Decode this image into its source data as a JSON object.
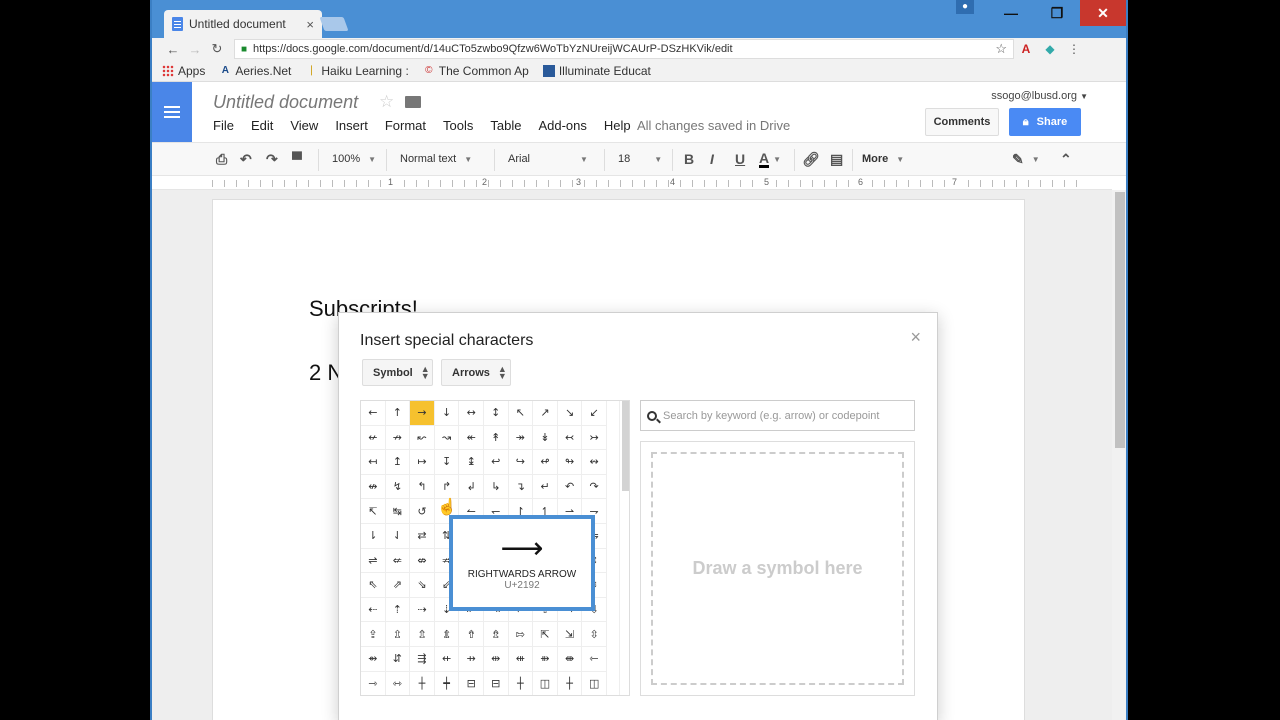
{
  "browser": {
    "tab_title": "Untitled document",
    "tab_close": "×",
    "url": "https://docs.google.com/document/d/14uCTo5zwbo9Qfzw6WoTbYzNUreijWCAUrP-DSzHKVik/edit",
    "window_controls": {
      "minimize": "—",
      "maximize": "❐",
      "close": "✕"
    },
    "bookmarks": [
      "Apps",
      "Aeries.Net",
      "Haiku Learning : ",
      "The Common Ap",
      "Illuminate Educat"
    ]
  },
  "docs": {
    "title": "Untitled document",
    "menu": [
      "File",
      "Edit",
      "View",
      "Insert",
      "Format",
      "Tools",
      "Table",
      "Add-ons",
      "Help"
    ],
    "save_status": "All changes saved in Drive",
    "account": "ssogo@lbusd.org",
    "comments_label": "Comments",
    "share_label": "Share"
  },
  "toolbar": {
    "zoom": "100%",
    "style": "Normal text",
    "font": "Arial",
    "size": "18",
    "bold": "B",
    "italic": "I",
    "underline": "U",
    "text_color": "A",
    "more": "More"
  },
  "ruler": [
    "1",
    "2",
    "3",
    "4",
    "5",
    "6",
    "7"
  ],
  "document": {
    "line1": "Subscripts!",
    "line2": "2 N"
  },
  "dialog": {
    "title": "Insert special characters",
    "close": "×",
    "category": "Symbol",
    "subcategory": "Arrows",
    "search_placeholder": "Search by keyword (e.g. arrow) or codepoint",
    "draw_hint": "Draw a symbol here",
    "preview": {
      "glyph": "⟶",
      "name": "RIGHTWARDS ARROW",
      "code": "U+2192"
    },
    "grid": [
      [
        "←",
        "↑",
        "→",
        "↓",
        "↔",
        "↕",
        "↖",
        "↗",
        "↘",
        "↙"
      ],
      [
        "↚",
        "↛",
        "↜",
        "↝",
        "↞",
        "↟",
        "↠",
        "↡",
        "↢",
        "↣"
      ],
      [
        "↤",
        "↥",
        "↦",
        "↧",
        "↨",
        "↩",
        "↪",
        "↫",
        "↬",
        "↭"
      ],
      [
        "↮",
        "↯",
        "↰",
        "↱",
        "↲",
        "↳",
        "↴",
        "↵",
        "↶",
        "↷"
      ],
      [
        "↸",
        "↹",
        "↺",
        "↻",
        "↼",
        "↽",
        "↾",
        "↿",
        "⇀",
        "⇁"
      ],
      [
        "⇂",
        "⇃",
        "⇄",
        "⇅",
        "⇆",
        "⇇",
        "⇈",
        "⇉",
        "⇊",
        "⇋"
      ],
      [
        "⇌",
        "⇍",
        "⇎",
        "⇏",
        "⇐",
        "⇑",
        "⇒",
        "⇓",
        "⇔",
        "⇕"
      ],
      [
        "⇖",
        "⇗",
        "⇘",
        "⇙",
        "⇚",
        "⇛",
        "⇜",
        "⇝",
        "⇞",
        "⇟"
      ],
      [
        "⇠",
        "⇡",
        "⇢",
        "⇣",
        "⇤",
        "⇥",
        "⇦",
        "⇧",
        "⇨",
        "⇩"
      ],
      [
        "⇪",
        "⇫",
        "⇬",
        "⇭",
        "⇮",
        "⇯",
        "⇰",
        "⇱",
        "⇲",
        "⇳"
      ],
      [
        "⇴",
        "⇵",
        "⇶",
        "⇷",
        "⇸",
        "⇹",
        "⇺",
        "⇻",
        "⇼",
        "⇽"
      ],
      [
        "⇾",
        "⇿",
        "┼",
        "┿",
        "⊟",
        "⊟",
        "┼",
        "◫",
        "┼",
        "◫"
      ]
    ],
    "selected_index": 2
  }
}
